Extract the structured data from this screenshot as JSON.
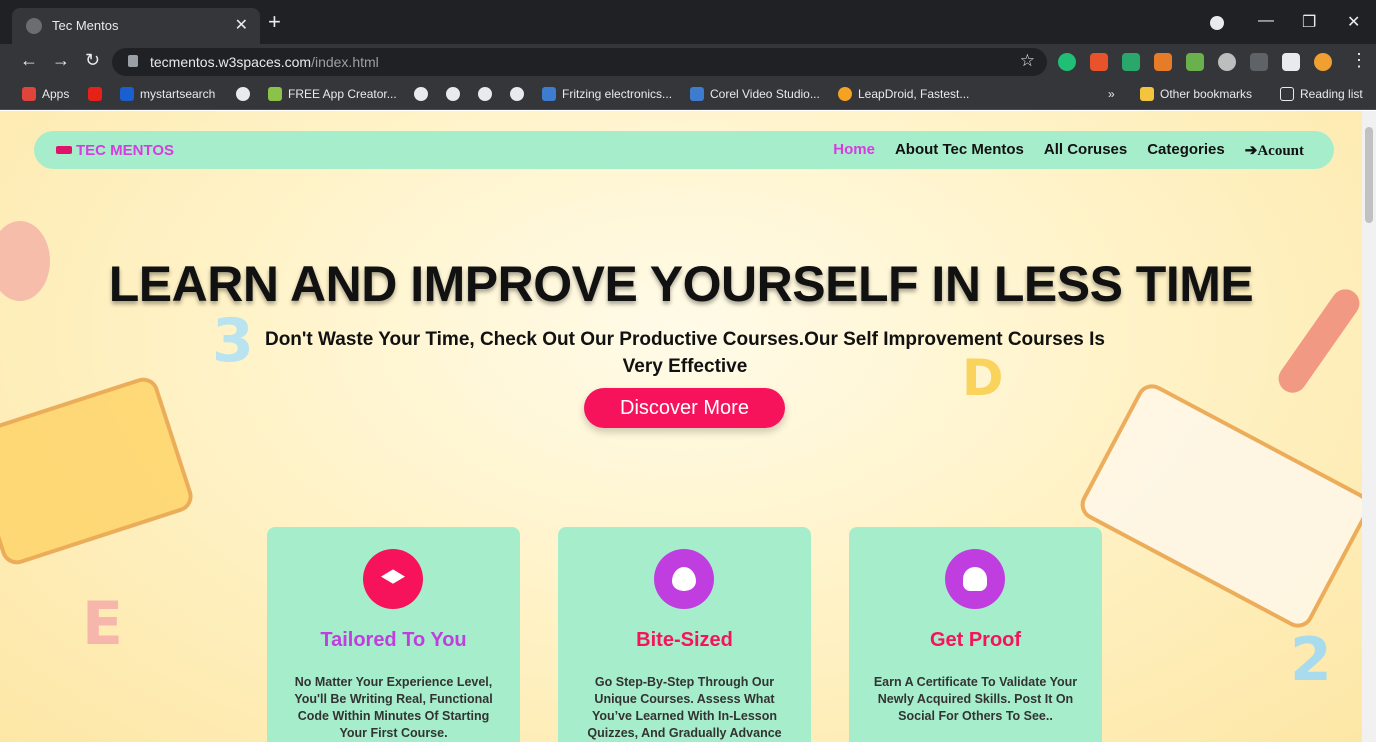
{
  "browser": {
    "tab_title": "Tec Mentos",
    "url_host": "tecmentos.w3spaces.com",
    "url_path": "/index.html",
    "bookmarks": [
      {
        "label": "Apps"
      },
      {
        "label": "mystartsearch"
      },
      {
        "label": "FREE App Creator..."
      },
      {
        "label": "Fritzing electronics..."
      },
      {
        "label": "Corel Video Studio..."
      },
      {
        "label": "LeapDroid, Fastest..."
      }
    ],
    "other_bookmarks": "Other bookmarks",
    "reading_list": "Reading list",
    "more_glyph": "»"
  },
  "site": {
    "brand": "TEC MENTOS",
    "nav": [
      "Home",
      "About Tec Mentos",
      "All Coruses",
      "Categories",
      "Acount"
    ],
    "hero_title": "LEARN AND IMPROVE YOURSELF IN LESS TIME",
    "hero_subtitle": "Don't Waste Your Time, Check Out Our Productive Courses.Our Self Improvement Courses Is Very Effective",
    "cta": "Discover More",
    "cards": [
      {
        "title": "Tailored To You",
        "title_color": "#c03ee0",
        "icon_color": "#f7135c",
        "icon": "graduation-cap-icon",
        "text": "No Matter Your Experience Level, You'll Be Writing Real, Functional Code Within Minutes Of Starting Your First Course."
      },
      {
        "title": "Bite-Sized",
        "title_color": "#f7135c",
        "icon_color": "#c03ee0",
        "icon": "flame-icon",
        "text": "Go Step-By-Step Through Our Unique Courses. Assess What You’ve Learned With In-Lesson Quizzes, And Gradually Advance"
      },
      {
        "title": "Get Proof",
        "title_color": "#f7135c",
        "icon_color": "#c03ee0",
        "icon": "award-icon",
        "text": "Earn A Certificate To Validate Your Newly Acquired Skills. Post It On Social For Others To See.."
      }
    ]
  },
  "colors": {
    "nav_bg": "#a6eecb",
    "accent_pink": "#f7135c",
    "accent_purple": "#d63ce0"
  }
}
